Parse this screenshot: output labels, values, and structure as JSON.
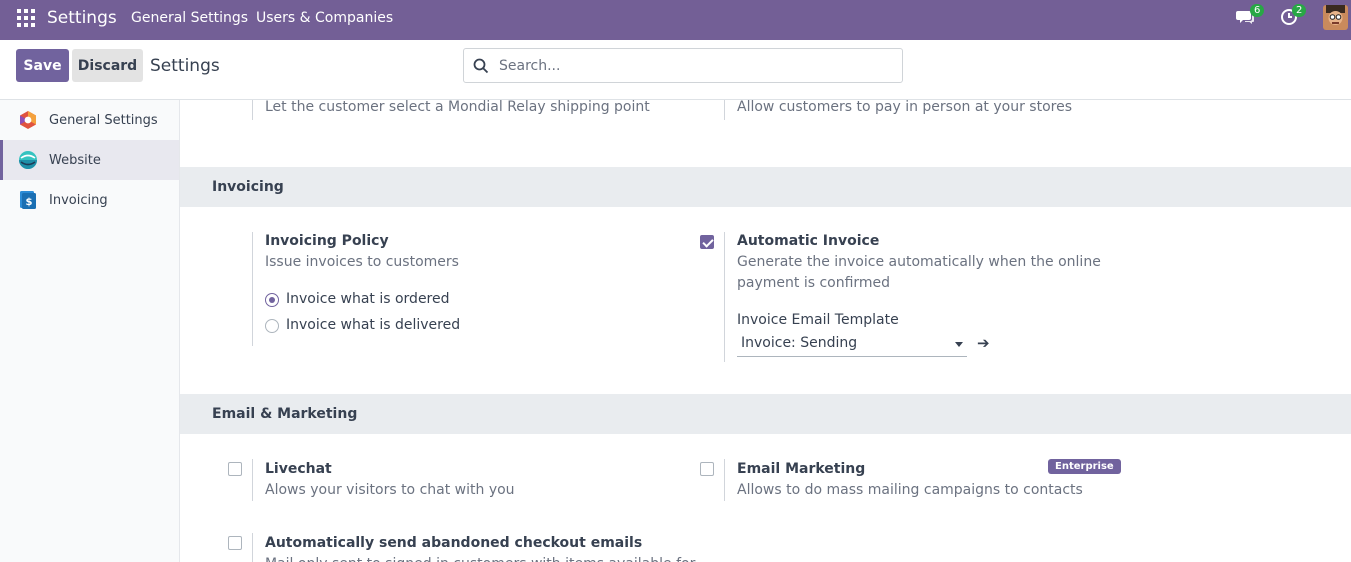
{
  "navbar": {
    "app_name": "Settings",
    "menu": [
      "General Settings",
      "Users & Companies"
    ],
    "messages_count": "6",
    "activities_count": "2"
  },
  "control_panel": {
    "save_label": "Save",
    "discard_label": "Discard",
    "breadcrumb": "Settings",
    "search_placeholder": "Search..."
  },
  "sidebar": {
    "items": [
      {
        "label": "General Settings",
        "icon": "odoo-hexagon-icon",
        "active": false
      },
      {
        "label": "Website",
        "icon": "website-app-icon",
        "active": true
      },
      {
        "label": "Invoicing",
        "icon": "invoicing-app-icon",
        "active": false
      }
    ]
  },
  "content": {
    "top_partial": {
      "left_desc": "Let the customer select a Mondial Relay shipping point",
      "right_desc": "Allow customers to pay in person at your stores"
    },
    "invoicing": {
      "section_title": "Invoicing",
      "policy": {
        "title": "Invoicing Policy",
        "desc": "Issue invoices to customers",
        "options": [
          "Invoice what is ordered",
          "Invoice what is delivered"
        ],
        "selected": "Invoice what is ordered"
      },
      "automatic_invoice": {
        "title": "Automatic Invoice",
        "checked": true,
        "desc": "Generate the invoice automatically when the online payment is confirmed",
        "template_label": "Invoice Email Template",
        "template_value": "Invoice: Sending"
      }
    },
    "email_marketing": {
      "section_title": "Email & Marketing",
      "livechat": {
        "title": "Livechat",
        "desc": "Alows your visitors to chat with you",
        "checked": false
      },
      "email_marketing": {
        "title": "Email Marketing",
        "desc": "Allows to do mass mailing campaigns to contacts",
        "badge": "Enterprise",
        "checked": false
      },
      "abandoned": {
        "title": "Automatically send abandoned checkout emails",
        "desc": "Mail only sent to signed in customers with items available for",
        "checked": false
      }
    }
  },
  "colors": {
    "navbar": "#735f96",
    "primary": "#71639e",
    "success_badge": "#28a745"
  }
}
